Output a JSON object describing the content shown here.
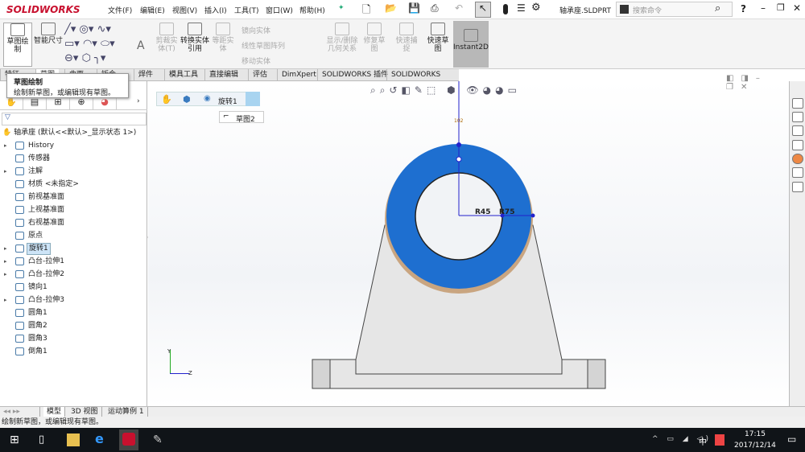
{
  "app": {
    "logo": "SOLIDWORKS",
    "doc_title": "轴承座.SLDPRT",
    "search_placeholder": "搜索命令"
  },
  "menu": [
    "文件(F)",
    "编辑(E)",
    "视图(V)",
    "插入(I)",
    "工具(T)",
    "窗口(W)",
    "帮助(H)"
  ],
  "ribbon": {
    "sketch": "草图绘制",
    "smart_dim": "智能尺寸",
    "trim": "剪裁实体(T)",
    "convert": "转换实体引用",
    "offset": "等距实体",
    "mirror": "镜向实体",
    "linear_pattern": "线性草图阵列",
    "move": "移动实体",
    "relations": "显示/删除几何关系",
    "repair": "修复草图",
    "quick_snap": "快速捕捉",
    "rapid_sketch": "快速草图",
    "instant2d": "Instant2D"
  },
  "tabs": [
    "特征",
    "草图",
    "曲面",
    "钣金",
    "焊件",
    "模具工具",
    "直接编辑",
    "评估",
    "DimXpert",
    "SOLIDWORKS 插件",
    "SOLIDWORKS MBD"
  ],
  "tooltip": {
    "title": "草图绘制",
    "body": "绘制新草图，或编辑现有草图。"
  },
  "breadcrumb": {
    "feature": "旋转1",
    "sketch": "草图2"
  },
  "tree": {
    "root": "轴承座 (默认<<默认>_显示状态 1>)",
    "items": [
      {
        "label": "History",
        "expand": true
      },
      {
        "label": "传感器",
        "expand": false
      },
      {
        "label": "注解",
        "expand": true
      },
      {
        "label": "材质 <未指定>",
        "expand": false
      },
      {
        "label": "前视基准面",
        "expand": false
      },
      {
        "label": "上视基准面",
        "expand": false
      },
      {
        "label": "右视基准面",
        "expand": false
      },
      {
        "label": "原点",
        "expand": false
      },
      {
        "label": "旋转1",
        "expand": true,
        "selected": true
      },
      {
        "label": "凸台-拉伸1",
        "expand": true
      },
      {
        "label": "凸台-拉伸2",
        "expand": true
      },
      {
        "label": "镜向1",
        "expand": false
      },
      {
        "label": "凸台-拉伸3",
        "expand": true
      },
      {
        "label": "圆角1",
        "expand": false
      },
      {
        "label": "圆角2",
        "expand": false
      },
      {
        "label": "圆角3",
        "expand": false
      },
      {
        "label": "倒角1",
        "expand": false
      }
    ]
  },
  "dims": {
    "r_inner": "R45",
    "r_outer": "R75",
    "top": "102"
  },
  "axes": {
    "y": "Y",
    "z": "Z"
  },
  "bottom_tabs": [
    "模型",
    "3D 视图",
    "运动算例 1"
  ],
  "status": "绘制新草图，或编辑现有草图。",
  "taskbar": {
    "time": "17:15",
    "date": "2017/12/14",
    "ime": "中"
  },
  "colors": {
    "face": "#1e6fd0",
    "body": "#e6e6e6",
    "accent": "#c8102e"
  }
}
